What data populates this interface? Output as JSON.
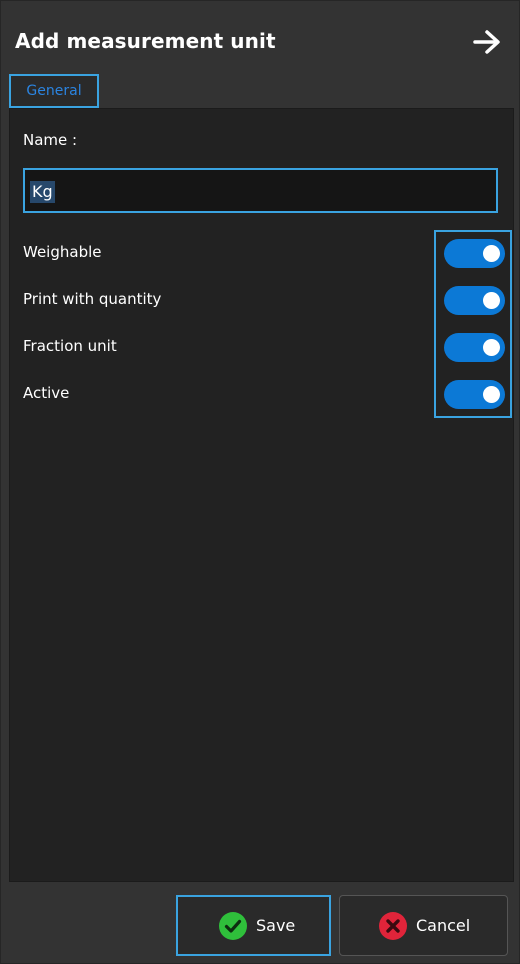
{
  "dialog": {
    "title": "Add measurement unit",
    "close_icon": "arrow-right-icon"
  },
  "tabs": [
    {
      "label": "General",
      "active": true
    }
  ],
  "form": {
    "name_label": "Name :",
    "name_value": "Kg",
    "options": [
      {
        "label": "Weighable",
        "enabled": true
      },
      {
        "label": "Print with quantity",
        "enabled": true
      },
      {
        "label": "Fraction unit",
        "enabled": true
      },
      {
        "label": "Active",
        "enabled": true
      }
    ]
  },
  "footer": {
    "save_label": "Save",
    "save_icon": "check-circle-icon",
    "cancel_label": "Cancel",
    "cancel_icon": "x-circle-icon"
  },
  "colors": {
    "accent_border": "#3aa3e0",
    "toggle_on": "#0c79d6",
    "save_icon": "#2fbf3b",
    "cancel_icon": "#e0243a",
    "tab_text": "#2b84e0"
  }
}
